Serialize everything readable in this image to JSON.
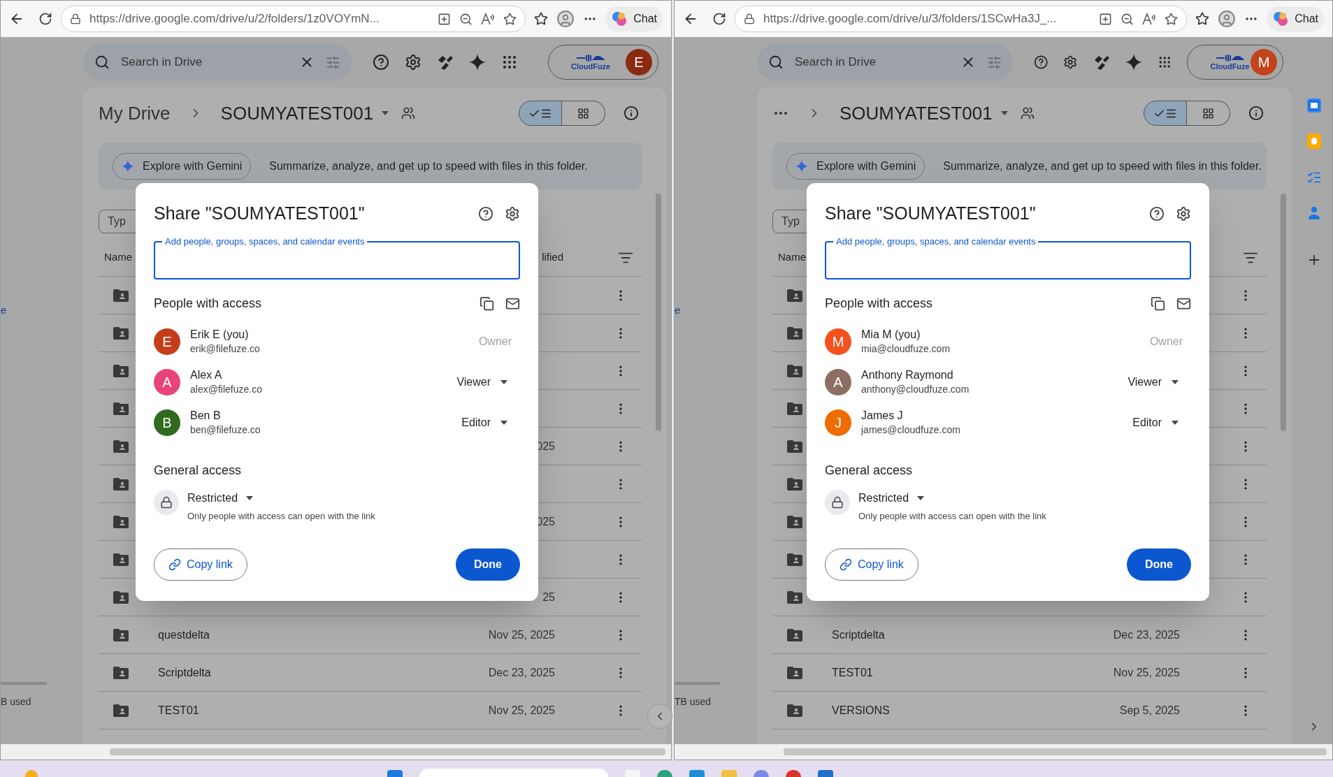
{
  "windows": [
    {
      "url": "https://drive.google.com/drive/u/2/folders/1z0VOYmN...",
      "chat": "Chat",
      "side_panel": false,
      "search": {
        "placeholder": "Search in Drive"
      },
      "account": {
        "brand": "CloudFuze",
        "initial": "E",
        "color": "#8b2a10"
      },
      "breadcrumb": {
        "parent": "My Drive",
        "current": "SOUMYATEST001"
      },
      "view": [
        {
          "kind": "list",
          "selected": true
        },
        {
          "kind": "grid",
          "selected": false
        }
      ],
      "gemini": {
        "button": "Explore with Gemini",
        "text": "Summarize, analyze, and get up to speed with files in this folder."
      },
      "filter_chip": "Typ",
      "columns": [
        "Name",
        "lified"
      ],
      "rows": [
        {},
        {},
        {},
        {},
        {
          "modified": "025"
        },
        {},
        {
          "modified": "025"
        },
        {},
        {
          "modified": "25"
        },
        {
          "name": "questdelta",
          "modified": "Nov 25, 2025"
        },
        {
          "name": "Scriptdelta",
          "modified": "Dec 23, 2025"
        },
        {
          "name": "TEST01",
          "modified": "Nov 25, 2025"
        }
      ],
      "sidebar": {
        "link": "e",
        "storage": "B used"
      },
      "dialog": {
        "title": "Share \"SOUMYATEST001\"",
        "input_label": "Add people, groups, spaces, and calendar events",
        "people_heading": "People with access",
        "people": [
          {
            "initial": "E",
            "color": "#c43e1c",
            "name": "Erik E (you)",
            "email": "erik@filefuze.co",
            "role": "Owner",
            "kind": "owner"
          },
          {
            "initial": "A",
            "color": "#e8437b",
            "name": "Alex A",
            "email": "alex@filefuze.co",
            "role": "Viewer",
            "kind": "role"
          },
          {
            "initial": "B",
            "color": "#2f6a1f",
            "name": "Ben B",
            "email": "ben@filefuze.co",
            "role": "Editor",
            "kind": "role"
          }
        ],
        "general_heading": "General access",
        "access": "Restricted",
        "access_note": "Only people with access can open with the link",
        "copy_link": "Copy link",
        "done": "Done"
      }
    },
    {
      "url": "https://drive.google.com/drive/u/3/folders/1SCwHa3J_...",
      "chat": "Chat",
      "side_panel": true,
      "search": {
        "placeholder": "Search in Drive"
      },
      "account": {
        "brand": "CloudFuze",
        "initial": "M",
        "color": "#c2441d"
      },
      "breadcrumb": {
        "current": "SOUMYATEST001"
      },
      "view": [
        {
          "kind": "list",
          "selected": true
        },
        {
          "kind": "grid",
          "selected": false
        }
      ],
      "gemini": {
        "button": "Explore with Gemini",
        "text": "Summarize, analyze, and get up to speed with files in this folder."
      },
      "filter_chip": "Typ",
      "columns": [
        "Name"
      ],
      "rows": [
        {},
        {},
        {},
        {},
        {},
        {},
        {},
        {},
        {},
        {
          "name": "Scriptdelta",
          "modified": "Dec 23, 2025"
        },
        {
          "name": "TEST01",
          "modified": "Nov 25, 2025"
        },
        {
          "name": "VERSIONS",
          "modified": "Sep 5, 2025"
        }
      ],
      "sidebar": {
        "link": "e",
        "storage": "TB used"
      },
      "dialog": {
        "title": "Share \"SOUMYATEST001\"",
        "input_label": "Add people, groups, spaces, and calendar events",
        "people_heading": "People with access",
        "people": [
          {
            "initial": "M",
            "color": "#f4511e",
            "name": "Mia M (you)",
            "email": "mia@cloudfuze.com",
            "role": "Owner",
            "kind": "owner"
          },
          {
            "initial": "A",
            "color": "#8d6e63",
            "name": "Anthony Raymond",
            "email": "anthony@cloudfuze.com",
            "role": "Viewer",
            "kind": "role"
          },
          {
            "initial": "J",
            "color": "#ef6c00",
            "name": "James J",
            "email": "james@cloudfuze.com",
            "role": "Editor",
            "kind": "role"
          }
        ],
        "general_heading": "General access",
        "access": "Restricted",
        "access_note": "Only people with access can open with the link",
        "copy_link": "Copy link",
        "done": "Done"
      }
    }
  ]
}
